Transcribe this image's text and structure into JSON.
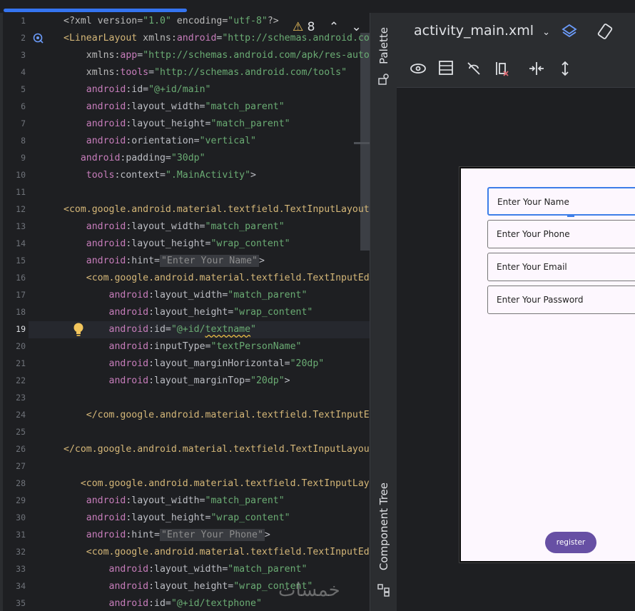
{
  "editor": {
    "warnings": {
      "count": "8"
    },
    "current_line": 19,
    "lines": [
      {
        "n": "1",
        "html": "<span class='attr'>&lt;?xml version=</span><span class='str'>\"1.0\"</span><span class='attr'> encoding=</span><span class='str'>\"utf-8\"</span><span class='attr'>?&gt;</span>"
      },
      {
        "n": "2",
        "html": "<span class='tag'>&lt;LinearLayout</span> <span class='attr'>xmlns:</span><span class='ns'>android</span>=<span class='str'>\"http://schemas.android.com/apk/res/android\"</span>"
      },
      {
        "n": "3",
        "html": "    <span class='attr'>xmlns:</span><span class='ns'>app</span>=<span class='str'>\"http://schemas.android.com/apk/res-auto\"</span>"
      },
      {
        "n": "4",
        "html": "    <span class='attr'>xmlns:</span><span class='ns'>tools</span>=<span class='str'>\"http://schemas.android.com/tools\"</span>"
      },
      {
        "n": "5",
        "html": "    <span class='ns'>android</span>:id=<span class='str'>\"@+id/main\"</span>"
      },
      {
        "n": "6",
        "html": "    <span class='ns'>android</span>:layout_width=<span class='str'>\"match_parent\"</span>"
      },
      {
        "n": "7",
        "html": "    <span class='ns'>android</span>:layout_height=<span class='str'>\"match_parent\"</span>"
      },
      {
        "n": "8",
        "html": "    <span class='ns'>android</span>:orientation=<span class='str'>\"vertical\"</span>"
      },
      {
        "n": "9",
        "html": "   <span class='ns'>android</span>:padding=<span class='str'>\"30dp\"</span>"
      },
      {
        "n": "10",
        "html": "    <span class='ns'>tools</span>:context=<span class='str'>\".MainActivity\"</span>&gt;"
      },
      {
        "n": "11",
        "html": ""
      },
      {
        "n": "12",
        "html": "<span class='tag'>&lt;com.google.android.material.textfield.TextInputLayout</span>"
      },
      {
        "n": "13",
        "html": "    <span class='ns'>android</span>:layout_width=<span class='str'>\"match_parent\"</span>"
      },
      {
        "n": "14",
        "html": "    <span class='ns'>android</span>:layout_height=<span class='str'>\"wrap_content\"</span>"
      },
      {
        "n": "15",
        "html": "    <span class='ns'>android</span>:hint=<span class='hint'>\"Enter Your Name\"</span>&gt;"
      },
      {
        "n": "16",
        "html": "    <span class='tag'>&lt;com.google.android.material.textfield.TextInputEditText</span>"
      },
      {
        "n": "17",
        "html": "        <span class='ns'>android</span>:layout_width=<span class='str'>\"match_parent\"</span>"
      },
      {
        "n": "18",
        "html": "        <span class='ns'>android</span>:layout_height=<span class='str'>\"wrap_content\"</span>"
      },
      {
        "n": "19",
        "html": "        <span class='ns'>android</span>:id=<span class='str'>\"@+id/<span class='squig'>textname</span>\"</span>"
      },
      {
        "n": "20",
        "html": "        <span class='ns'>android</span>:inputType=<span class='str'>\"textPersonName\"</span>"
      },
      {
        "n": "21",
        "html": "        <span class='ns'>android</span>:layout_marginHorizontal=<span class='str'>\"20dp\"</span>"
      },
      {
        "n": "22",
        "html": "        <span class='ns'>android</span>:layout_marginTop=<span class='str'>\"20dp\"</span>&gt;"
      },
      {
        "n": "23",
        "html": ""
      },
      {
        "n": "24",
        "html": "    <span class='tag'>&lt;/com.google.android.material.textfield.TextInputEditText&gt;</span>"
      },
      {
        "n": "25",
        "html": ""
      },
      {
        "n": "26",
        "html": "<span class='tag'>&lt;/com.google.android.material.textfield.TextInputLayout&gt;</span>"
      },
      {
        "n": "27",
        "html": ""
      },
      {
        "n": "28",
        "html": "   <span class='tag'>&lt;com.google.android.material.textfield.TextInputLayout</span>"
      },
      {
        "n": "29",
        "html": "    <span class='ns'>android</span>:layout_width=<span class='str'>\"match_parent\"</span>"
      },
      {
        "n": "30",
        "html": "    <span class='ns'>android</span>:layout_height=<span class='str'>\"wrap_content\"</span>"
      },
      {
        "n": "31",
        "html": "    <span class='ns'>android</span>:hint=<span class='hint'>\"Enter Your Phone\"</span>&gt;"
      },
      {
        "n": "32",
        "html": "    <span class='tag'>&lt;com.google.android.material.textfield.TextInputEditText</span>"
      },
      {
        "n": "33",
        "html": "        <span class='ns'>android</span>:layout_width=<span class='str'>\"match_parent\"</span>"
      },
      {
        "n": "34",
        "html": "        <span class='ns'>android</span>:layout_height=<span class='str'>\"wrap_content\"</span>"
      },
      {
        "n": "35",
        "html": "        <span class='ns'>android</span>:id=<span class='str'>\"@+id/textphone\"</span>"
      }
    ]
  },
  "side_panel": {
    "palette": "Palette",
    "component_tree": "Component Tree"
  },
  "design": {
    "filename": "activity_main.xml",
    "fields": [
      "Enter Your Name",
      "Enter Your Phone",
      "Enter Your Email",
      "Enter Your Password"
    ],
    "button": "register"
  },
  "watermark": "خمسات"
}
